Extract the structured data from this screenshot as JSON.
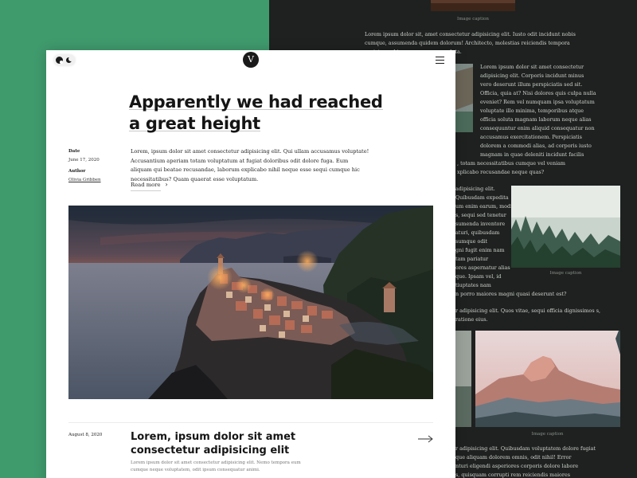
{
  "front": {
    "logo_letter": "V",
    "article": {
      "title": "Apparently we had reached a great height",
      "date_label": "Date",
      "date_value": "June 17, 2020",
      "author_label": "Author",
      "author_name": "Olivia Gribben",
      "lead": "Lorem, ipsum dolor sit amet consectetur adipisicing elit. Qui ullam accusamus voluptate! Accusantium aperiam totam voluptatum at fugiat doloribus odit dolore fuga. Eum aliquam qui beatae recusandae, laborum explicabo nihil neque esse sequi cumque hic necessitatibus? Quam quaerat esse voluptatum.",
      "read_more": "Read more",
      "read_more_arrow": "›"
    },
    "next_post": {
      "date": "August 8, 2020",
      "title": "Lorem, ipsum dolor sit amet consectetur adipisicing elit",
      "excerpt": "Lorem ipsum dolor sit amet consectetur adipisicing elit. Nemo tempora eum cumque neque voluptatem, odit ipsum consequatur animi."
    }
  },
  "dark": {
    "top_caption": "Image caption",
    "para1": "Lorem ipsum dolor sit, amet consectetur adipisicing elit. Iusto odit incidunt nobis cumque, assumenda quidem dolorum! Architecto, molestias reiciendis tempora pariatur nobis nam eum quam soluta.",
    "para2_lines": [
      "Lorem ipsum dolor sit amet consectetur",
      "adipisicing elit. Corporis incidunt minus",
      "vero deserunt illum perspiciatis sed sit.",
      "Officia, quia at? Nisi dolores quis culpa nulla",
      "eveniet? Rem vel numquam ipsa voluptatum",
      "voluptate illo minima, temporibus atque",
      "officia soluta magnam laborum neque alias",
      "consequuntur enim aliquid consequatur non",
      "accusamus exercitationem. Perspiciatis",
      "dolorem a commodi alias, ad corporis iusto",
      "magnam in quae deleniti incidunt facilis",
      ", totam necessitatibus cumque vel veniam",
      "xplicabo recusandae neque quas?"
    ],
    "para3_lines": [
      "adipisicing elit.",
      "Quibusdam expedita",
      "um enim earum, modi",
      "s, sequi sed tenetur",
      "sumenda inventore",
      "aturi, quibusdam",
      "sumque odit",
      "gni fugit enim nam",
      "tam pariatur",
      "ores aspernatur alias",
      "que. Ipsam vel, id",
      "tiuptates nam",
      "n porro maiores magni quasi deserunt est?"
    ],
    "caption_forest": "Image caption",
    "para4": "r adipisicing elit. Quos vitae, sequi officia dignissimos s, ratione eius.",
    "caption_mountain": "Image caption",
    "para5_lines": [
      "r adipisicing elit. Quibusdam voluptatem dolore fugiat",
      "que aliquam dolorem omnis, odit nihil! Error",
      "nturi eligendi asperiores corporis dolore labore",
      "s, quisquam corrupti rem reiciendis maiores"
    ]
  },
  "colors": {
    "green_background": "#3f9a6c",
    "dark_page": "#1e2120",
    "front_page": "#ffffff",
    "title_text": "#151515"
  },
  "icons": [
    "sun-icon",
    "moon-icon",
    "menu-icon",
    "chevron-right-icon",
    "arrow-right-icon"
  ]
}
